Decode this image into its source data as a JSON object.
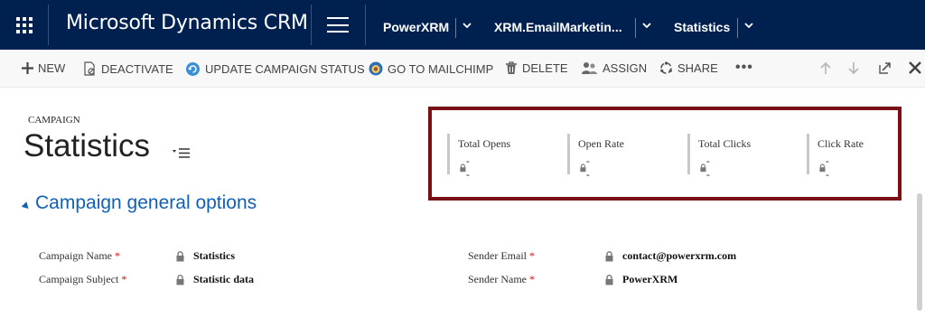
{
  "topbar": {
    "app_title": "Microsoft Dynamics CRM",
    "breadcrumbs": [
      "PowerXRM",
      "XRM.EmailMarketin...",
      "Statistics"
    ],
    "bg_color": "#002050"
  },
  "commands": {
    "new": "NEW",
    "deactivate": "DEACTIVATE",
    "update_campaign_status": "UPDATE CAMPAIGN STATUS",
    "go_to_mailchimp": "GO TO MAILCHIMP",
    "delete": "DELETE",
    "assign": "ASSIGN",
    "share": "SHARE",
    "more": "•••"
  },
  "record": {
    "entity_type": "CAMPAIGN",
    "title": "Statistics"
  },
  "stats": [
    {
      "label": "Total Opens",
      "value": "--"
    },
    {
      "label": "Open Rate",
      "value": "--"
    },
    {
      "label": "Total Clicks",
      "value": "--"
    },
    {
      "label": "Click Rate",
      "value": "--"
    }
  ],
  "section": {
    "title": "Campaign general options"
  },
  "fields": {
    "campaign_name": {
      "label": "Campaign Name",
      "value": "Statistics",
      "required": "*"
    },
    "campaign_subject": {
      "label": "Campaign Subject",
      "value": "Statistic data",
      "required": "*"
    },
    "sender_email": {
      "label": "Sender Email",
      "value": "contact@powerxrm.com",
      "required": "*"
    },
    "sender_name": {
      "label": "Sender Name",
      "value": "PowerXRM",
      "required": "*"
    }
  },
  "colors": {
    "accent": "#1160b7",
    "highlight_border": "#7a1015",
    "required": "#ee0000"
  }
}
